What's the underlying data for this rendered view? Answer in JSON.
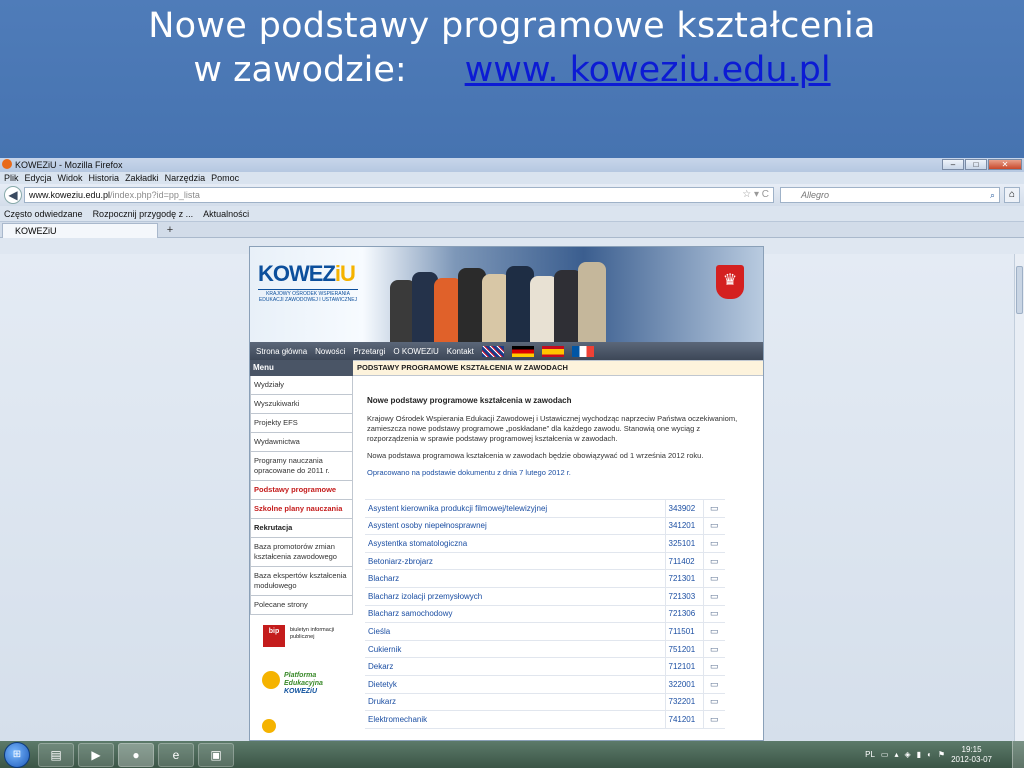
{
  "slide": {
    "title": "Nowe podstawy programowe kształcenia",
    "line2_prefix": "w zawodzie:",
    "link": "www. koweziu.edu.pl"
  },
  "browser": {
    "window_title": "KOWEZiU - Mozilla Firefox",
    "menu": [
      "Plik",
      "Edycja",
      "Widok",
      "Historia",
      "Zakładki",
      "Narzędzia",
      "Pomoc"
    ],
    "url_domain": "www.koweziu.edu.pl",
    "url_path": "/index.php?id=pp_lista",
    "search_placeholder": "Allegro",
    "bookmarks": [
      "Często odwiedzane",
      "Rozpocznij przygodę z ...",
      "Aktualności"
    ],
    "tab_label": "KOWEZiU",
    "new_tab": "+"
  },
  "site": {
    "logo_main": "KOWEZ",
    "logo_suffix": "iU",
    "logo_sub": "KRAJOWY OŚRODEK WSPIERANIA EDUKACJI ZAWODOWEJ I USTAWICZNEJ",
    "nav": [
      "Strona główna",
      "Nowości",
      "Przetargi",
      "O KOWEZiU",
      "Kontakt"
    ],
    "menu_header": "Menu",
    "menu_items": [
      {
        "label": "Wydziały"
      },
      {
        "label": "Wyszukiwarki"
      },
      {
        "label": "Projekty EFS"
      },
      {
        "label": "Wydawnictwa"
      },
      {
        "label": "Programy nauczania opracowane do 2011 r."
      },
      {
        "label": "Podstawy programowe"
      },
      {
        "label": "Szkolne plany nauczania"
      },
      {
        "label": "Rekrutacja"
      },
      {
        "label": "Baza promotorów zmian kształcenia zawodowego"
      },
      {
        "label": "Baza ekspertów kształcenia modułowego"
      },
      {
        "label": "Polecane strony"
      }
    ],
    "bip_logo": "bip",
    "bip_text": "biuletyn informacji publicznej",
    "pek_text1": "Platforma",
    "pek_text2": "Edukacyjna",
    "pek_text3": "KOWEZiU",
    "content_header": "PODSTAWY PROGRAMOWE KSZTAŁCENIA W ZAWODACH",
    "content_title": "Nowe podstawy programowe kształcenia w zawodach",
    "content_p1": "Krajowy Ośrodek Wspierania Edukacji Zawodowej i Ustawicznej wychodząc naprzeciw Państwa oczekiwaniom, zamieszcza nowe podstawy programowe „poskładane” dla każdego zawodu. Stanowią one wyciąg z rozporządzenia w sprawie podstawy programowej kształcenia w zawodach.",
    "content_p2": "Nowa podstawa programowa kształcenia w zawodach będzie obowiązywać od 1 września 2012 roku.",
    "content_link": "Opracowano na podstawie dokumentu z dnia 7 lutego 2012 r.",
    "professions": [
      {
        "name": "Asystent kierownika produkcji filmowej/telewizyjnej",
        "code": "343902"
      },
      {
        "name": "Asystent osoby niepełnosprawnej",
        "code": "341201"
      },
      {
        "name": "Asystentka stomatologiczna",
        "code": "325101"
      },
      {
        "name": "Betoniarz-zbrojarz",
        "code": "711402"
      },
      {
        "name": "Blacharz",
        "code": "721301"
      },
      {
        "name": "Blacharz izolacji przemysłowych",
        "code": "721303"
      },
      {
        "name": "Blacharz samochodowy",
        "code": "721306"
      },
      {
        "name": "Cieśla",
        "code": "711501"
      },
      {
        "name": "Cukiernik",
        "code": "751201"
      },
      {
        "name": "Dekarz",
        "code": "712101"
      },
      {
        "name": "Dietetyk",
        "code": "322001"
      },
      {
        "name": "Drukarz",
        "code": "732201"
      },
      {
        "name": "Elektromechanik",
        "code": "741201"
      }
    ]
  },
  "taskbar": {
    "lang": "PL",
    "time": "19:15",
    "date": "2012-03-07"
  }
}
